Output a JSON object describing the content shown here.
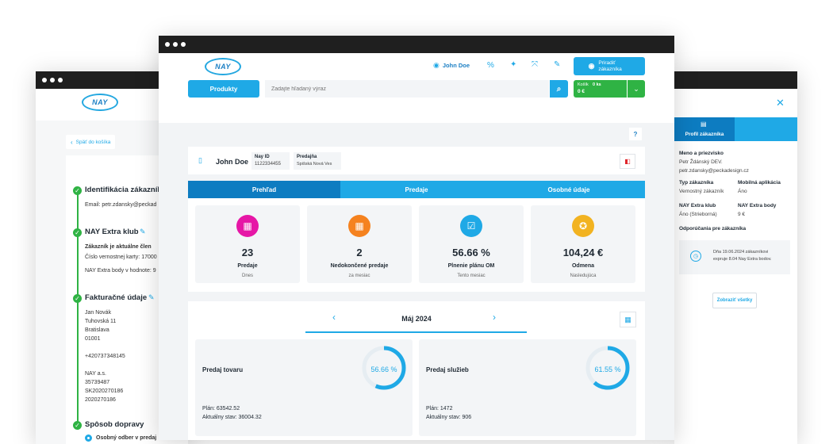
{
  "left": {
    "back": "Späť do košíka",
    "section1": {
      "title": "Identifikácia zákazník",
      "email": "Email: petr.zdansky@peckad"
    },
    "section2": {
      "title": "NAY Extra klub",
      "line1": "Zákazník je aktuálne člen",
      "line2": "Číslo vernostnej karty: 17000",
      "line3": "NAY Extra body v hodnote: 9"
    },
    "section3": {
      "title": "Fakturačné údaje",
      "lines": [
        "Jan Novák",
        "Tuhovská 11",
        "Bratislava",
        "01001",
        "",
        "+420737348145",
        "",
        "NAY a.s.",
        "35739487",
        "SK2020270186",
        "2020270186"
      ]
    },
    "section4": {
      "title": "Spôsob dopravy",
      "option": "Osobný odber v predaj"
    }
  },
  "main": {
    "logo": "NAY",
    "user": "John Doe",
    "assign_customer": "Priradiť zákazníka",
    "products_button": "Produkty",
    "search_placeholder": "Zadajte hľadaný výraz",
    "cart_label": "Košík",
    "cart_count": "0 ks",
    "cart_price": "0 €",
    "help": "?",
    "customer": {
      "name": "John Doe",
      "nay_id_label": "Nay ID",
      "nay_id": "1122334455",
      "store_label": "Predajňa",
      "store": "Spišská Nová Ves"
    },
    "tabs": [
      "Prehľad",
      "Predaje",
      "Osobné údaje"
    ],
    "stats": [
      {
        "value": "23",
        "label": "Predaje",
        "sub": "Dnes",
        "color": "#e617a6"
      },
      {
        "value": "2",
        "label": "Nedokončené predaje",
        "sub": "za mesiac",
        "color": "#f5821f"
      },
      {
        "value": "56.66 %",
        "label": "Plnenie plánu OM",
        "sub": "Tento mesiac",
        "color": "#1fa9e6"
      },
      {
        "value": "104,24 €",
        "label": "Odmena",
        "sub": "Nasledujúca",
        "color": "#f2b321"
      }
    ],
    "month": "Máj 2024",
    "sales": [
      {
        "title": "Predaj tovaru",
        "percent": "56.66 %",
        "progress": 0.5666,
        "plan": "Plán: 63542.52",
        "current": "Aktuálny stav: 36004.32"
      },
      {
        "title": "Predaj služieb",
        "percent": "61.55 %",
        "progress": 0.6155,
        "plan": "Plán: 1472",
        "current": "Aktuálny stav: 906"
      }
    ]
  },
  "right": {
    "profile_tab": "Profil zákazníka",
    "name_label": "Meno a priezvisko",
    "name": "Petr Ždánský DEV.",
    "email": "petr.zdansky@peckadesign.cz",
    "type_label": "Typ zákazníka",
    "type": "Vernostný zákazník",
    "app_label": "Mobilná aplikácia",
    "app": "Áno",
    "club_label": "NAY Extra klub",
    "club": "Áno (Strieborná)",
    "points_label": "NAY Extra body",
    "points": "9 €",
    "rec_label": "Odporúčania pre zákazníka",
    "rec_text1": "Dňa 19.06.2024 zákazníkovi",
    "rec_text2": "expruje 8.04 Nay Extra bodov.",
    "show_all": "Zobraziť všetky"
  }
}
